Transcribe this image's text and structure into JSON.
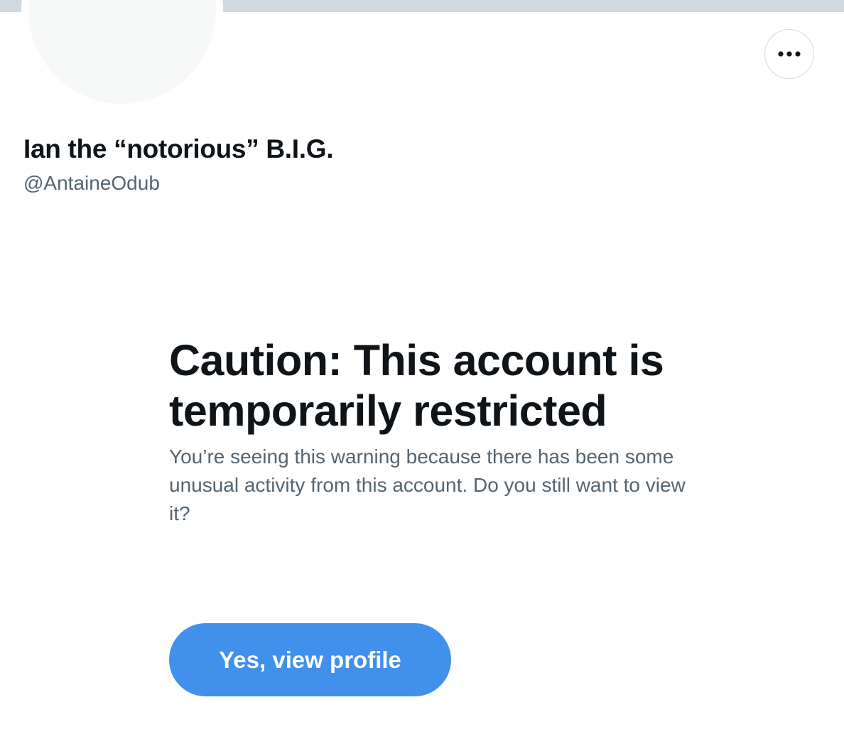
{
  "profile": {
    "display_name": "Ian the “notorious” B.I.G.",
    "handle": "@AntaineOdub",
    "more_icon": "more-horizontal-icon"
  },
  "warning": {
    "title": "Caution: This account is temporarily restricted",
    "message": "You’re seeing this warning because there has been some unusual activity from this account. Do you still want to view it?",
    "button_label": "Yes, view profile"
  },
  "colors": {
    "banner": "#cfd9de",
    "button_background": "#4090ec",
    "secondary_text": "#536471",
    "primary_text": "#0f1419"
  }
}
